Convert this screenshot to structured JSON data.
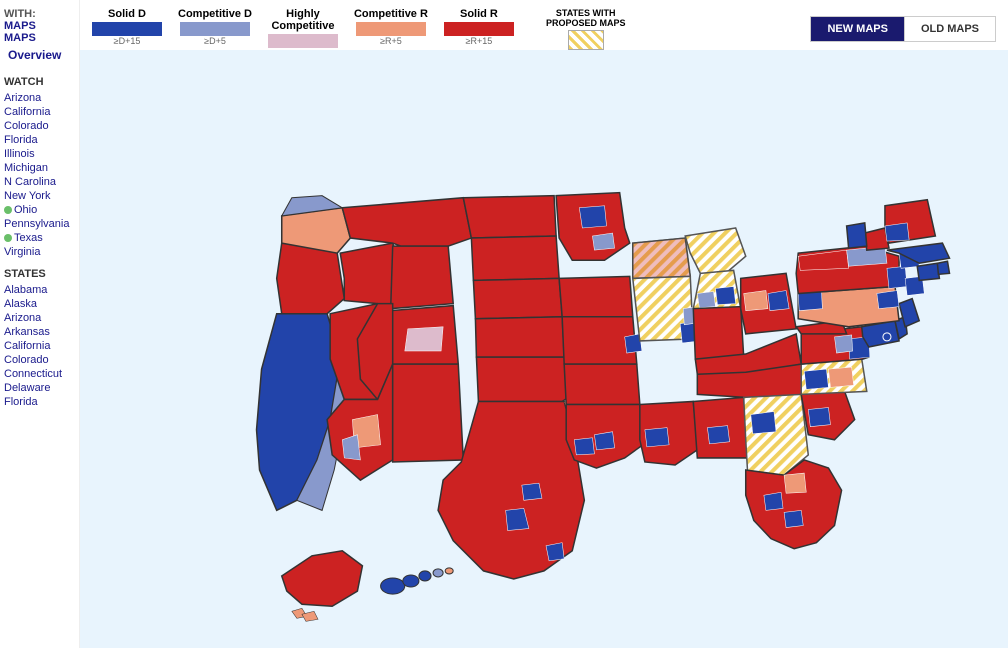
{
  "sidebar": {
    "with_label": "WITH:",
    "maps_label1": "MAPS",
    "maps_label2": "MAPS",
    "overview_label": "Overview",
    "watch_header": "WATCH",
    "watch_items": [
      {
        "label": "Arizona",
        "icon": null
      },
      {
        "label": "California",
        "icon": null
      },
      {
        "label": "Colorado",
        "icon": null
      },
      {
        "label": "Florida",
        "icon": null
      },
      {
        "label": "Illinois",
        "icon": null
      },
      {
        "label": "Michigan",
        "icon": null
      },
      {
        "label": "Carolina",
        "icon": null
      },
      {
        "label": "ew York",
        "icon": null
      },
      {
        "label": "Ohio",
        "icon": "green"
      },
      {
        "label": "sylvania",
        "icon": null
      },
      {
        "label": "Texas",
        "icon": "green"
      },
      {
        "label": "Virginia",
        "icon": null
      }
    ],
    "states_header": "STATES",
    "states_items": [
      {
        "label": "Alabama",
        "icon": null
      },
      {
        "label": "Alaska",
        "icon": null
      },
      {
        "label": "Arizona",
        "icon": null
      },
      {
        "label": "rkansas",
        "icon": null
      },
      {
        "label": "California",
        "icon": null
      },
      {
        "label": "Colorado",
        "icon": null
      },
      {
        "label": "necticut",
        "icon": null
      },
      {
        "label": "elaware",
        "icon": null
      },
      {
        "label": "Florida",
        "icon": null
      }
    ]
  },
  "legend": {
    "solid_d": {
      "label": "Solid D",
      "sublabel": "≥D+15",
      "color": "#2244aa"
    },
    "competitive_d": {
      "label": "Competitive D",
      "sublabel": "≥D+5",
      "color": "#8899dd"
    },
    "highly_competitive": {
      "label": "Highly\nCompetitive",
      "sublabel": "",
      "color": "#ddbbcc"
    },
    "competitive_r": {
      "label": "Competitive R",
      "sublabel": "≥R+5",
      "color": "#ee9988"
    },
    "solid_r": {
      "label": "Solid R",
      "sublabel": "≥R+15",
      "color": "#cc2222"
    },
    "proposed": {
      "label": "STATES WITH\nPROPOSED MAPS",
      "color": "#f0d060"
    }
  },
  "toggle": {
    "new_maps": "NEW MAPS",
    "old_maps": "OLD MAPS"
  },
  "map": {
    "background_color": "#e8f4fd"
  }
}
